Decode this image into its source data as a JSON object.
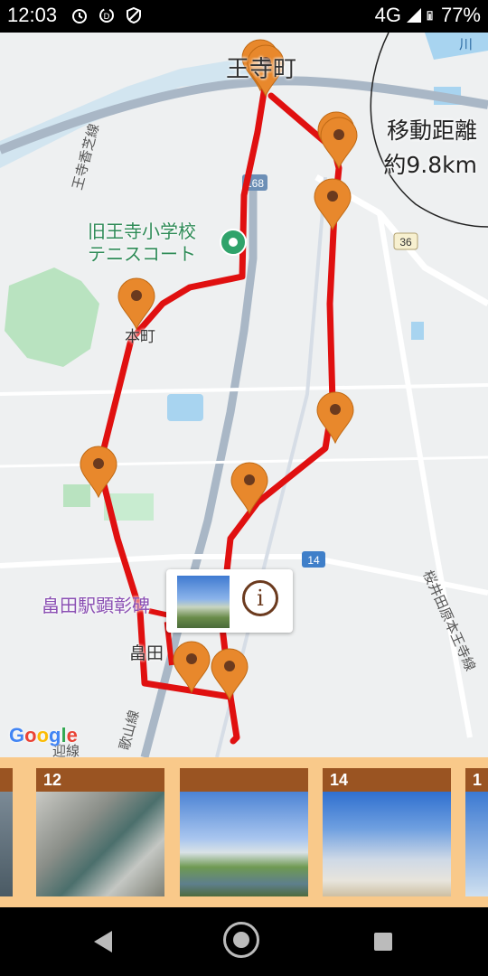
{
  "status_bar": {
    "time": "12:03",
    "network": "4G",
    "battery": "77%"
  },
  "map": {
    "distance_label": "移動距離",
    "distance_value": "約9.8km",
    "place_names": {
      "top_town": "王寺町",
      "honmachi": "本町",
      "hatada": "畠田"
    },
    "poi": {
      "name_line1": "旧王寺小学校",
      "name_line2": "テニスコート"
    },
    "memorial": "畠田駅顕彰碑",
    "route_numbers": {
      "r168": "168",
      "r36": "36",
      "r14": "14"
    },
    "rail_lines": {
      "ouji_kashiba": "王寺香芝線",
      "sakurai_line": "桜井田原本王寺線",
      "wakayama_line": "歌山線",
      "bottom_line": "迎線"
    },
    "google_logo": "Google",
    "river_label": "川"
  },
  "popup": {
    "info_symbol": "i"
  },
  "photo_strip": {
    "cards": [
      {
        "number": "12"
      },
      {
        "number": ""
      },
      {
        "number": "14"
      },
      {
        "number": "1"
      }
    ]
  }
}
